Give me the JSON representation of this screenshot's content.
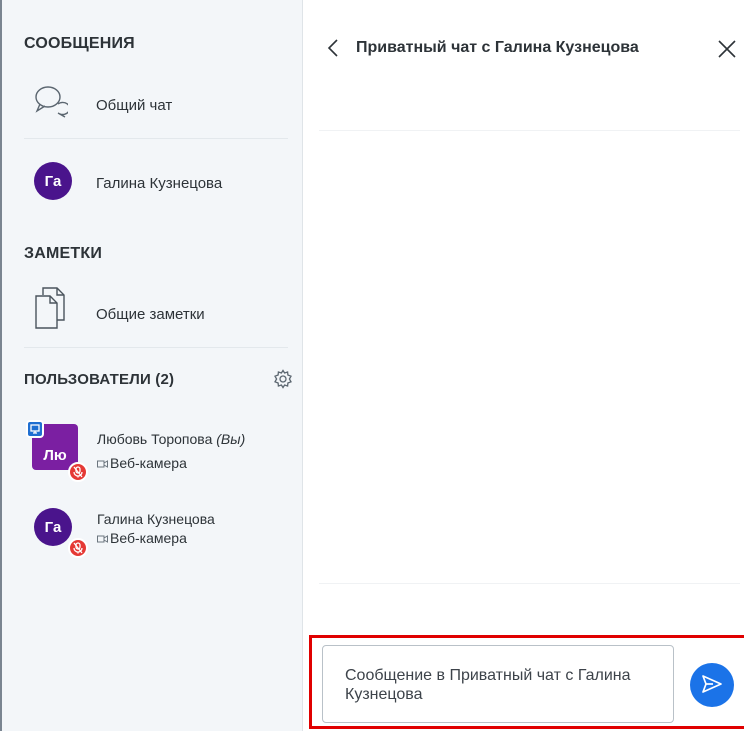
{
  "sidebar": {
    "messages_title": "СООБЩЕНИЯ",
    "public_chat_label": "Общий чат",
    "private_chat_label": "Галина Кузнецова",
    "private_chat_avatar": "Га",
    "notes_title": "ЗАМЕТКИ",
    "shared_notes_label": "Общие заметки",
    "users_title": "ПОЛЬЗОВАТЕЛИ (2)",
    "users": [
      {
        "initials": "Лю",
        "name": "Любовь Торопова",
        "you_tag": "(Вы)",
        "status": "Веб-камера",
        "presenter": true
      },
      {
        "initials": "Га",
        "name": "Галина Кузнецова",
        "you_tag": "",
        "status": "Веб-камера",
        "presenter": false
      }
    ]
  },
  "chat": {
    "title": "Приватный чат с Галина Кузнецова",
    "input_placeholder": "Сообщение в Приватный чат с Галина Кузнецова"
  },
  "icons": {
    "public_chat": "speech-bubbles-icon",
    "notes": "copy-documents-icon",
    "settings": "gear-icon",
    "presenter": "presentation-screen-icon",
    "muted": "mic-muted-icon",
    "webcam": "video-camera-icon",
    "back": "chevron-left-icon",
    "close": "close-icon",
    "send": "send-icon"
  },
  "colors": {
    "avatar_dark": "#4a148c",
    "avatar_purple": "#7b1fa2",
    "mute_red": "#e53935",
    "presenter_blue": "#1f6fd1",
    "send_blue": "#1b73e8",
    "highlight_red": "#e00000"
  }
}
